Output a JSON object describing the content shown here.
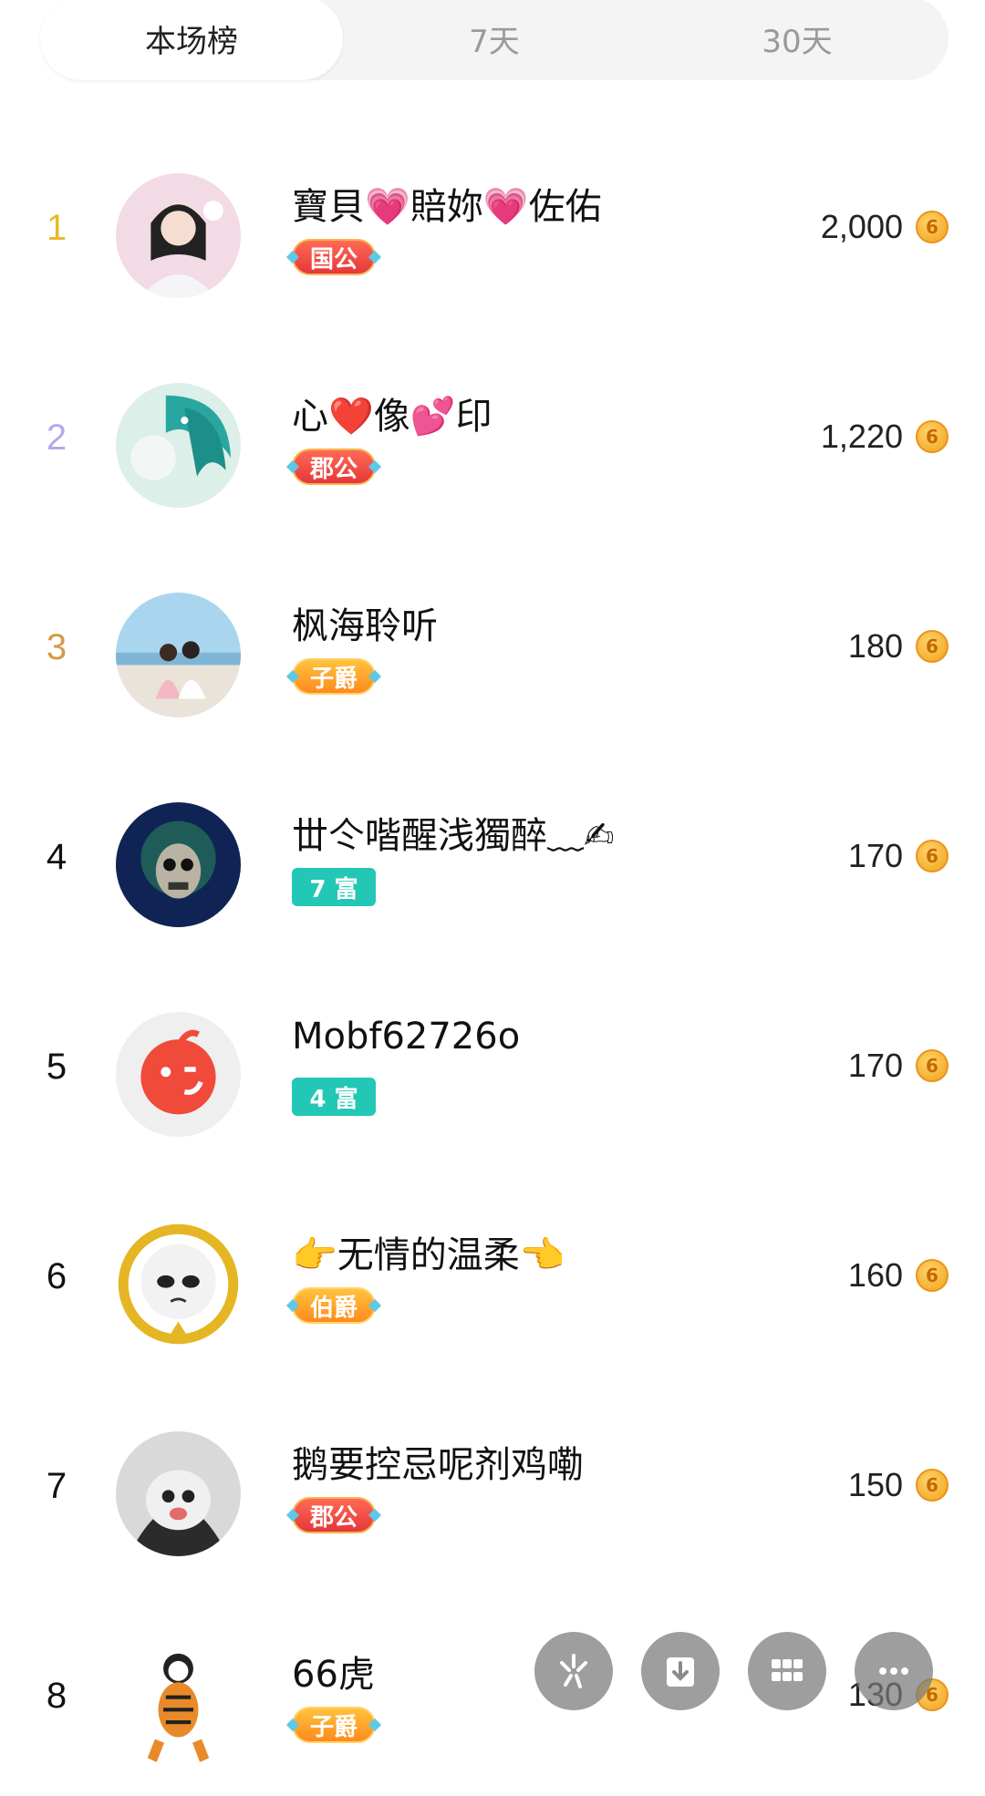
{
  "tabs": [
    {
      "label": "本场榜",
      "active": true
    },
    {
      "label": "7天",
      "active": false
    },
    {
      "label": "30天",
      "active": false
    }
  ],
  "rank_colors": {
    "1": "#e7b92a",
    "2": "#b7a8e8",
    "3": "#d59a4a",
    "default": "#111111"
  },
  "rows": [
    {
      "rank": "1",
      "name": "寶貝💗賠妳💗佐佑",
      "badge": "国公",
      "badge_style": "red",
      "score": "2,000"
    },
    {
      "rank": "2",
      "name": "心❤️像💕印",
      "badge": "郡公",
      "badge_style": "red",
      "score": "1,220"
    },
    {
      "rank": "3",
      "name": "枫海聆听",
      "badge": "子爵",
      "badge_style": "orange",
      "score": "180"
    },
    {
      "rank": "4",
      "name": "丗仒喈醒浅獨醉﹏✍",
      "badge": "7 富",
      "badge_style": "teal",
      "score": "170"
    },
    {
      "rank": "5",
      "name": "Mobf62726o",
      "badge": "4 富",
      "badge_style": "teal",
      "score": "170"
    },
    {
      "rank": "6",
      "name": "👉无情的温柔👈",
      "badge": "伯爵",
      "badge_style": "orange",
      "score": "160"
    },
    {
      "rank": "7",
      "name": "鹅要控忌呢剂鸡嘞",
      "badge": "郡公",
      "badge_style": "red",
      "score": "150"
    },
    {
      "rank": "8",
      "name": "66虎",
      "badge": "子爵",
      "badge_style": "orange",
      "score": "130"
    }
  ],
  "coin_glyph": "6",
  "fab_icons": [
    "sparkle-icon",
    "download-icon",
    "grid-icon",
    "more-icon"
  ]
}
